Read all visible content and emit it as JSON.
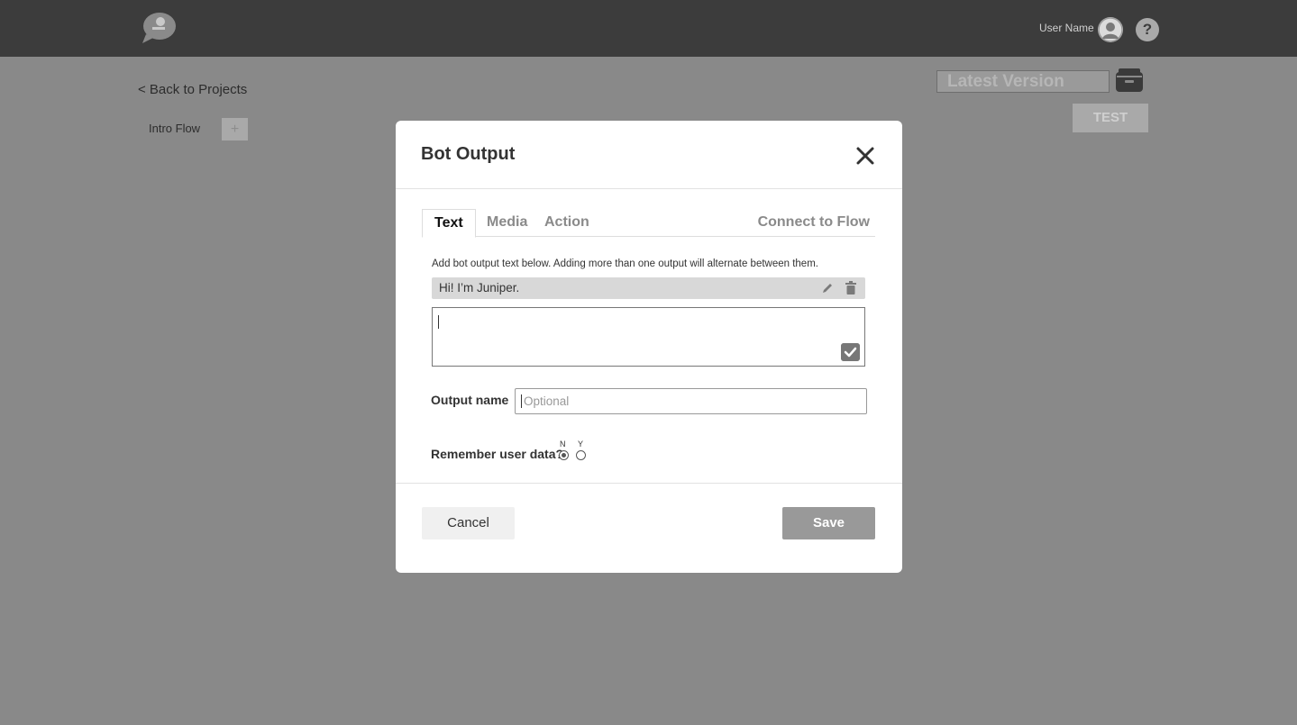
{
  "header": {
    "user_name": "User Name",
    "help_label": "?",
    "icons": [
      "logo-icon",
      "user-avatar-icon",
      "help-icon"
    ]
  },
  "page": {
    "back_link": "< Back to Projects",
    "flow_tab": "Intro Flow",
    "add_flow_label": "+",
    "version_value": "Latest Version",
    "test_label": "TEST"
  },
  "modal": {
    "title": "Bot Output",
    "tabs": [
      {
        "label": "Text",
        "active": true
      },
      {
        "label": "Media",
        "active": false
      },
      {
        "label": "Action",
        "active": false
      },
      {
        "label": "Connect to Flow",
        "active": false
      }
    ],
    "hint": "Add bot output text below. Adding more than one output will alternate between them.",
    "outputs": [
      {
        "text": "Hi! I’m Juniper."
      }
    ],
    "textarea_value": "",
    "output_name_label": "Output name",
    "output_name_placeholder": "Optional",
    "remember_label": "Remember user data?",
    "radio_n_label": "N",
    "radio_y_label": "Y",
    "remember_selected": "N",
    "cancel_label": "Cancel",
    "save_label": "Save"
  }
}
